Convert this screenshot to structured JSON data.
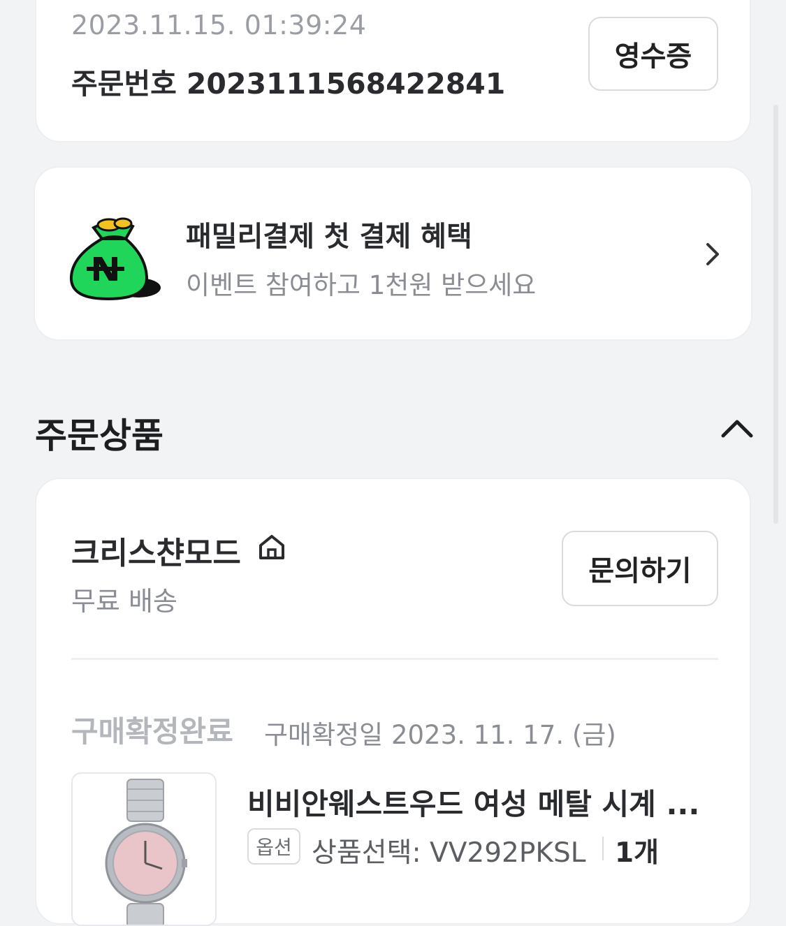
{
  "order": {
    "datetime": "2023.11.15. 01:39:24",
    "number_label": "주문번호",
    "number": "2023111568422841",
    "receipt_button": "영수증"
  },
  "event": {
    "title": "패밀리결제 첫 결제 혜택",
    "subtitle": "이벤트 참여하고 1천원 받으세요",
    "icon": "money-bag-icon",
    "colors": {
      "bag": "#1fd65a",
      "coin": "#f4c21e"
    }
  },
  "section": {
    "title": "주문상품",
    "toggle_icon": "chevron-up-icon"
  },
  "store": {
    "name": "크리스챤모드",
    "shipping": "무료 배송",
    "inquiry_button": "문의하기"
  },
  "item": {
    "status": "구매확정완료",
    "confirm_date": "구매확정일 2023. 11. 17. (금)",
    "name": "비비안웨스트우드 여성 메탈 시계 ...",
    "option_badge": "옵션",
    "option_text": "상품선택: VV292PKSL",
    "quantity": "1개"
  }
}
